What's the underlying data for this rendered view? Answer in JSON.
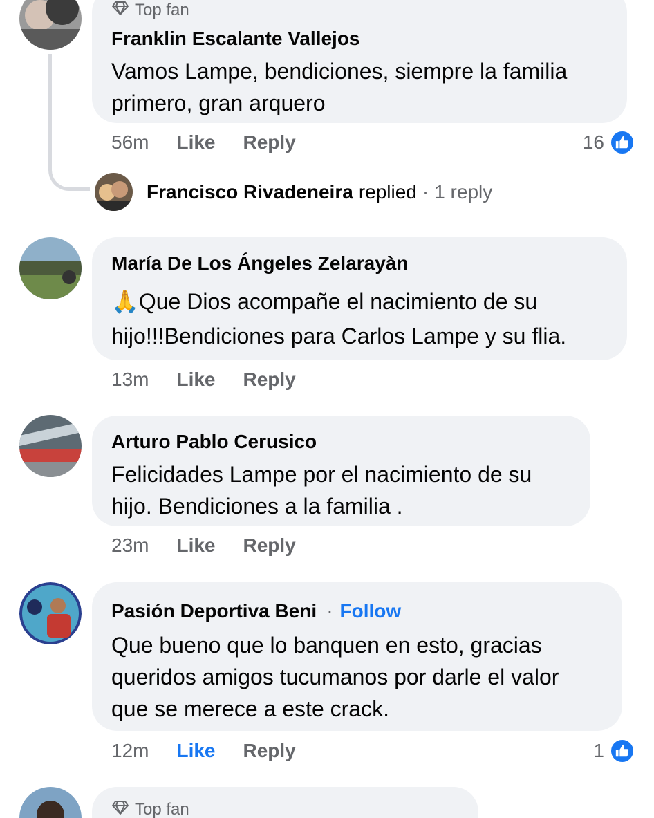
{
  "comments": [
    {
      "badge": "Top fan",
      "author": "Franklin Escalante Vallejos",
      "text_lines": [
        "Vamos Lampe, bendiciones, siempre la familia",
        "primero, gran arquero"
      ],
      "time": "56m",
      "like": "Like",
      "reply": "Reply",
      "reaction_count": "16"
    },
    {
      "author": "María De Los Ángeles Zelarayàn",
      "text_lines": [
        "🙏Que Dios acompañe  el nacimiento de su",
        "hijo!!!Bendiciones para Carlos Lampe y su flia."
      ],
      "time": "13m",
      "like": "Like",
      "reply": "Reply"
    },
    {
      "author": "Arturo Pablo Cerusico",
      "text_lines": [
        "Felicidades Lampe por el nacimiento de su",
        "hijo. Bendiciones a la familia ."
      ],
      "time": "23m",
      "like": "Like",
      "reply": "Reply"
    },
    {
      "author": "Pasión Deportiva Beni",
      "follow": "Follow",
      "text_lines": [
        "Que bueno que lo banquen en esto, gracias",
        "queridos amigos tucumanos por darle el valor",
        "que se merece a este crack."
      ],
      "time": "12m",
      "like": "Like",
      "reply": "Reply",
      "reaction_count": "1"
    },
    {
      "badge": "Top fan"
    }
  ],
  "reply_summary": {
    "name": "Francisco Rivadeneira",
    "replied": "replied",
    "count": "1 reply"
  },
  "colors": {
    "accent": "#1877f2",
    "bubble": "#f0f2f5",
    "muted": "#65676b"
  },
  "icons": [
    "diamond-icon",
    "like-reaction-icon"
  ]
}
